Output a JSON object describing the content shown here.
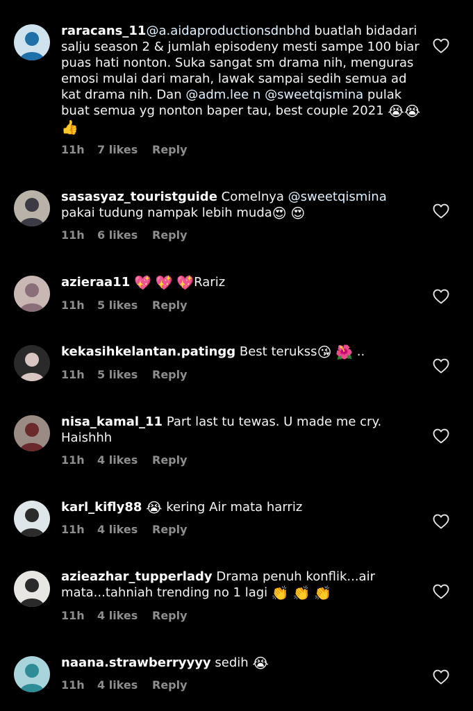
{
  "comments": [
    {
      "username": "raracans_11",
      "segments": [
        {
          "t": "mention",
          "v": "@a.aidaproductionsdnbhd"
        },
        {
          "t": "text",
          "v": " buatlah bidadari salju season 2 & jumlah episodeny mesti sampe 100 biar puas hati nonton. Suka sangat sm drama nih, menguras emosi mulai dari marah, lawak sampai sedih semua ad kat drama nih. Dan "
        },
        {
          "t": "mention",
          "v": "@adm.lee n"
        },
        {
          "t": "text",
          "v": " "
        },
        {
          "t": "mention",
          "v": "@sweetqismina"
        },
        {
          "t": "text",
          "v": " pulak buat semua yg nonton baper tau, best couple 2021 "
        },
        {
          "t": "emoji",
          "v": "😭"
        },
        {
          "t": "emoji",
          "v": "😭"
        },
        {
          "t": "emoji",
          "v": "👍"
        }
      ],
      "time": "11h",
      "likes": "7 likes",
      "reply": "Reply",
      "avatar": {
        "bg": "#cfe3ee",
        "fg": "#1f6fa8"
      }
    },
    {
      "username": "sasasyaz_touristguide",
      "segments": [
        {
          "t": "text",
          "v": " Comelnya "
        },
        {
          "t": "mention",
          "v": "@sweetqismina"
        },
        {
          "t": "text",
          "v": " pakai tudung nampak lebih muda"
        },
        {
          "t": "emoji",
          "v": "😍"
        },
        {
          "t": "text",
          "v": " "
        },
        {
          "t": "emoji",
          "v": "😍"
        }
      ],
      "time": "11h",
      "likes": "6 likes",
      "reply": "Reply",
      "avatar": {
        "bg": "#b8b2a8",
        "fg": "#3c3a44"
      }
    },
    {
      "username": "azieraa11",
      "segments": [
        {
          "t": "text",
          "v": " "
        },
        {
          "t": "emoji",
          "v": "💖"
        },
        {
          "t": "text",
          "v": " "
        },
        {
          "t": "emoji",
          "v": "💖"
        },
        {
          "t": "text",
          "v": " "
        },
        {
          "t": "emoji",
          "v": "💖"
        },
        {
          "t": "text",
          "v": "Rariz"
        }
      ],
      "time": "11h",
      "likes": "5 likes",
      "reply": "Reply",
      "avatar": {
        "bg": "#c9b7b4",
        "fg": "#8a6f78"
      }
    },
    {
      "username": "kekasihkelantan.patingg",
      "segments": [
        {
          "t": "text",
          "v": " Best terukss"
        },
        {
          "t": "emoji",
          "v": "😘"
        },
        {
          "t": "text",
          "v": " "
        },
        {
          "t": "emoji",
          "v": "🌺"
        },
        {
          "t": "text",
          "v": " .."
        }
      ],
      "time": "11h",
      "likes": "5 likes",
      "reply": "Reply",
      "avatar": {
        "bg": "#2a2a2a",
        "fg": "#d9c6c2"
      }
    },
    {
      "username": "nisa_kamal_11",
      "segments": [
        {
          "t": "text",
          "v": " Part last tu tewas. U made me cry. Haishhh"
        }
      ],
      "time": "11h",
      "likes": "4 likes",
      "reply": "Reply",
      "avatar": {
        "bg": "#9a8c84",
        "fg": "#6a2a2c"
      }
    },
    {
      "username": "karl_kifly88",
      "segments": [
        {
          "t": "text",
          "v": " "
        },
        {
          "t": "emoji",
          "v": "😭"
        },
        {
          "t": "text",
          "v": "  kering Air mata harriz"
        }
      ],
      "time": "11h",
      "likes": "4 likes",
      "reply": "Reply",
      "avatar": {
        "bg": "#dfe6ea",
        "fg": "#2b2b2b"
      }
    },
    {
      "username": "azieazhar_tupperlady",
      "segments": [
        {
          "t": "text",
          "v": " Drama penuh konflik...air mata...tahniah trending no 1 lagi "
        },
        {
          "t": "emoji",
          "v": "👏"
        },
        {
          "t": "text",
          "v": " "
        },
        {
          "t": "emoji",
          "v": "👏"
        },
        {
          "t": "text",
          "v": " "
        },
        {
          "t": "emoji",
          "v": "👏"
        }
      ],
      "time": "11h",
      "likes": "4 likes",
      "reply": "Reply",
      "avatar": {
        "bg": "#e8e6e2",
        "fg": "#2a2a2a"
      }
    },
    {
      "username": "naana.strawberryyyy",
      "segments": [
        {
          "t": "text",
          "v": " sedih "
        },
        {
          "t": "emoji",
          "v": "😭"
        }
      ],
      "time": "11h",
      "likes": "4 likes",
      "reply": "Reply",
      "avatar": {
        "bg": "#a9d4dc",
        "fg": "#2e8c96"
      }
    }
  ]
}
